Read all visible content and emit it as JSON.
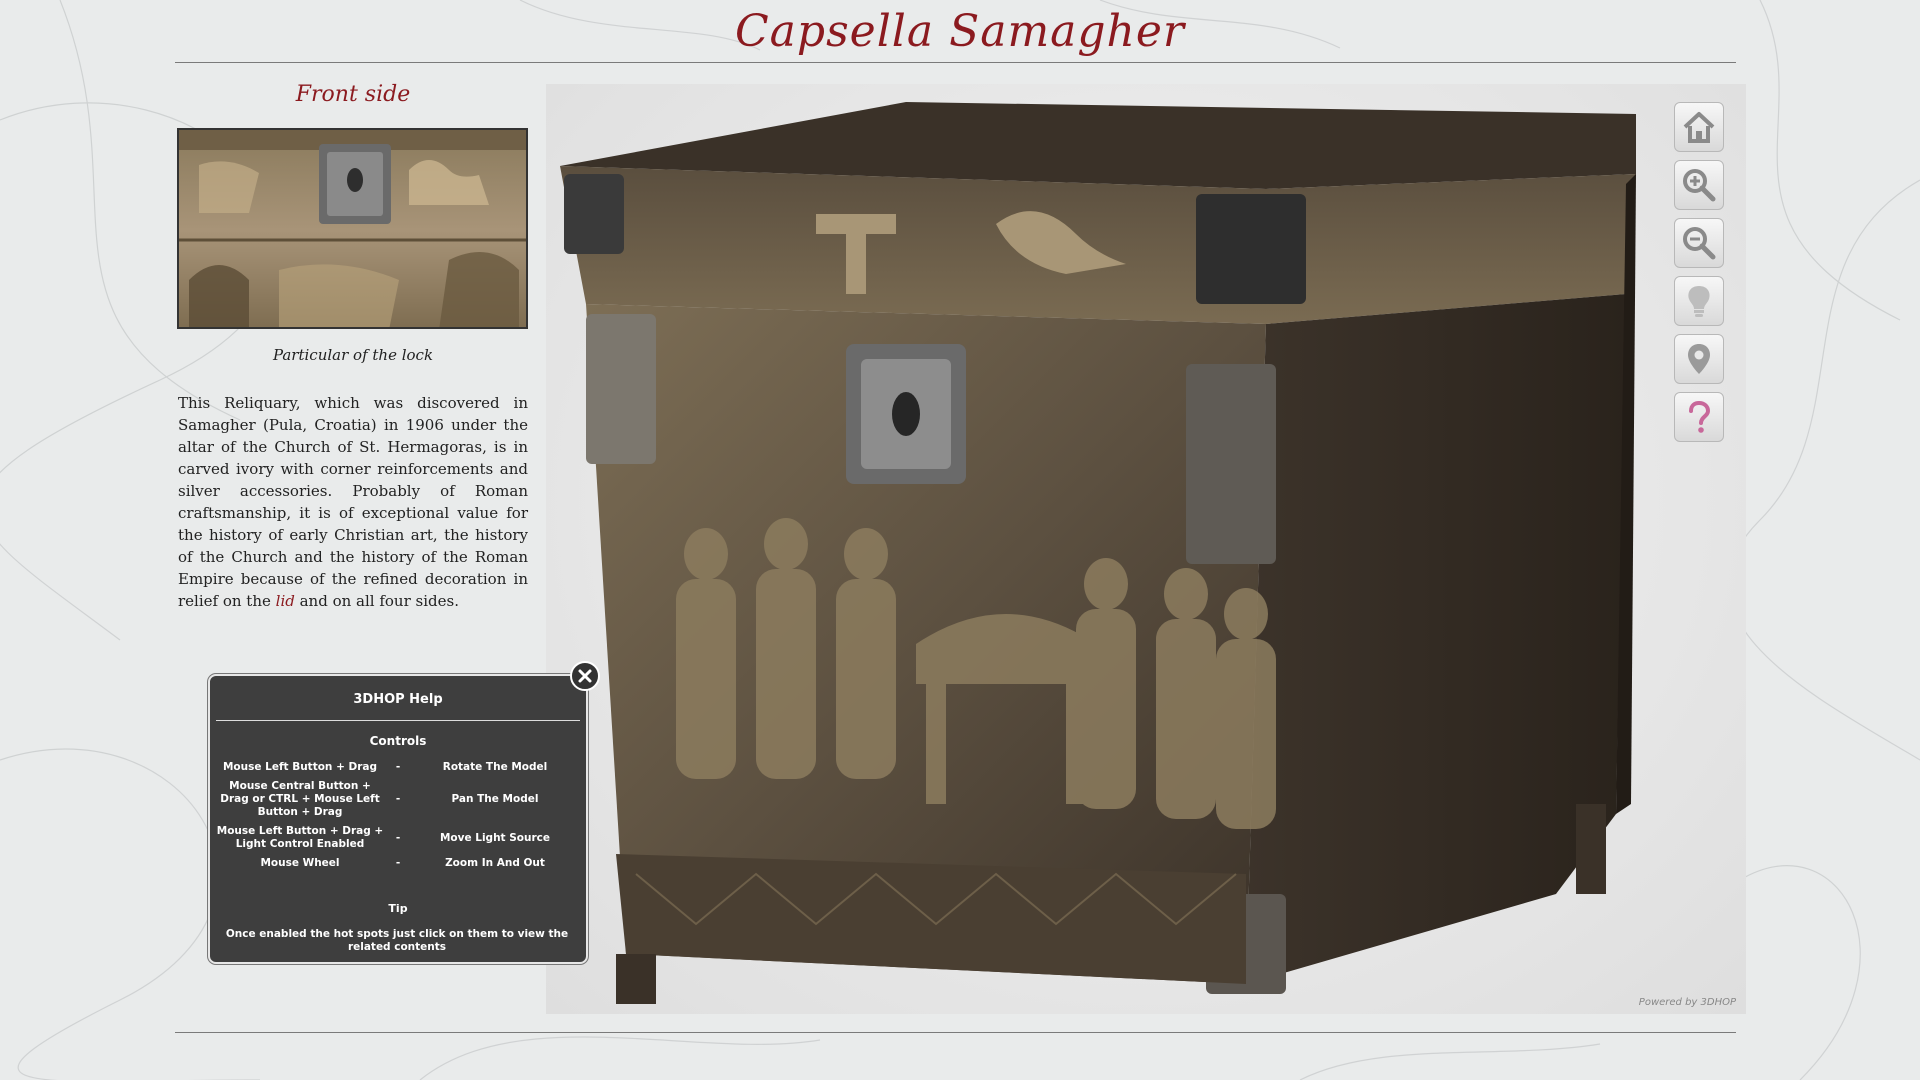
{
  "header": {
    "title": "Capsella Samagher"
  },
  "sidebar": {
    "section_title": "Front side",
    "thumbnail_caption": "Particular of the lock",
    "description_before": "This Reliquary, which was discovered in Samagher (Pula, Croatia) in 1906 under the altar of the Church of St. Hermagoras, is in carved ivory with corner reinforcements and silver accessories. Probably of Roman craftsmanship, it is of exceptional value for the history of early Christian art, the history of the Church and the history of the Roman Empire because of the refined decoration in relief on the ",
    "description_link": "lid",
    "description_after": " and on all four sides."
  },
  "viewer": {
    "powered_by": "Powered by 3DHOP",
    "toolbar": [
      {
        "name": "home",
        "icon": "home-icon"
      },
      {
        "name": "zoom-in",
        "icon": "zoom-in-icon"
      },
      {
        "name": "zoom-out",
        "icon": "zoom-out-icon"
      },
      {
        "name": "light",
        "icon": "lightbulb-icon"
      },
      {
        "name": "hotspots",
        "icon": "map-pin-icon"
      },
      {
        "name": "help",
        "icon": "question-icon"
      }
    ]
  },
  "help": {
    "title": "3DHOP Help",
    "controls_heading": "Controls",
    "rows": [
      {
        "action": "Mouse Left Button + Drag",
        "sep": "-",
        "effect": "Rotate The Model"
      },
      {
        "action": "Mouse Central Button + Drag or CTRL + Mouse Left Button + Drag",
        "sep": "-",
        "effect": "Pan The Model"
      },
      {
        "action": "Mouse Left Button + Drag + Light Control Enabled",
        "sep": "-",
        "effect": "Move Light Source"
      },
      {
        "action": "Mouse Wheel",
        "sep": "-",
        "effect": "Zoom In And Out"
      }
    ],
    "tip_heading": "Tip",
    "tip_text": "Once enabled the hot spots just click on them to view the related contents"
  },
  "colors": {
    "title_red": "#8b1a1f",
    "panel_bg": "#3e3e3e",
    "help_icon_pink": "#c8689a"
  }
}
